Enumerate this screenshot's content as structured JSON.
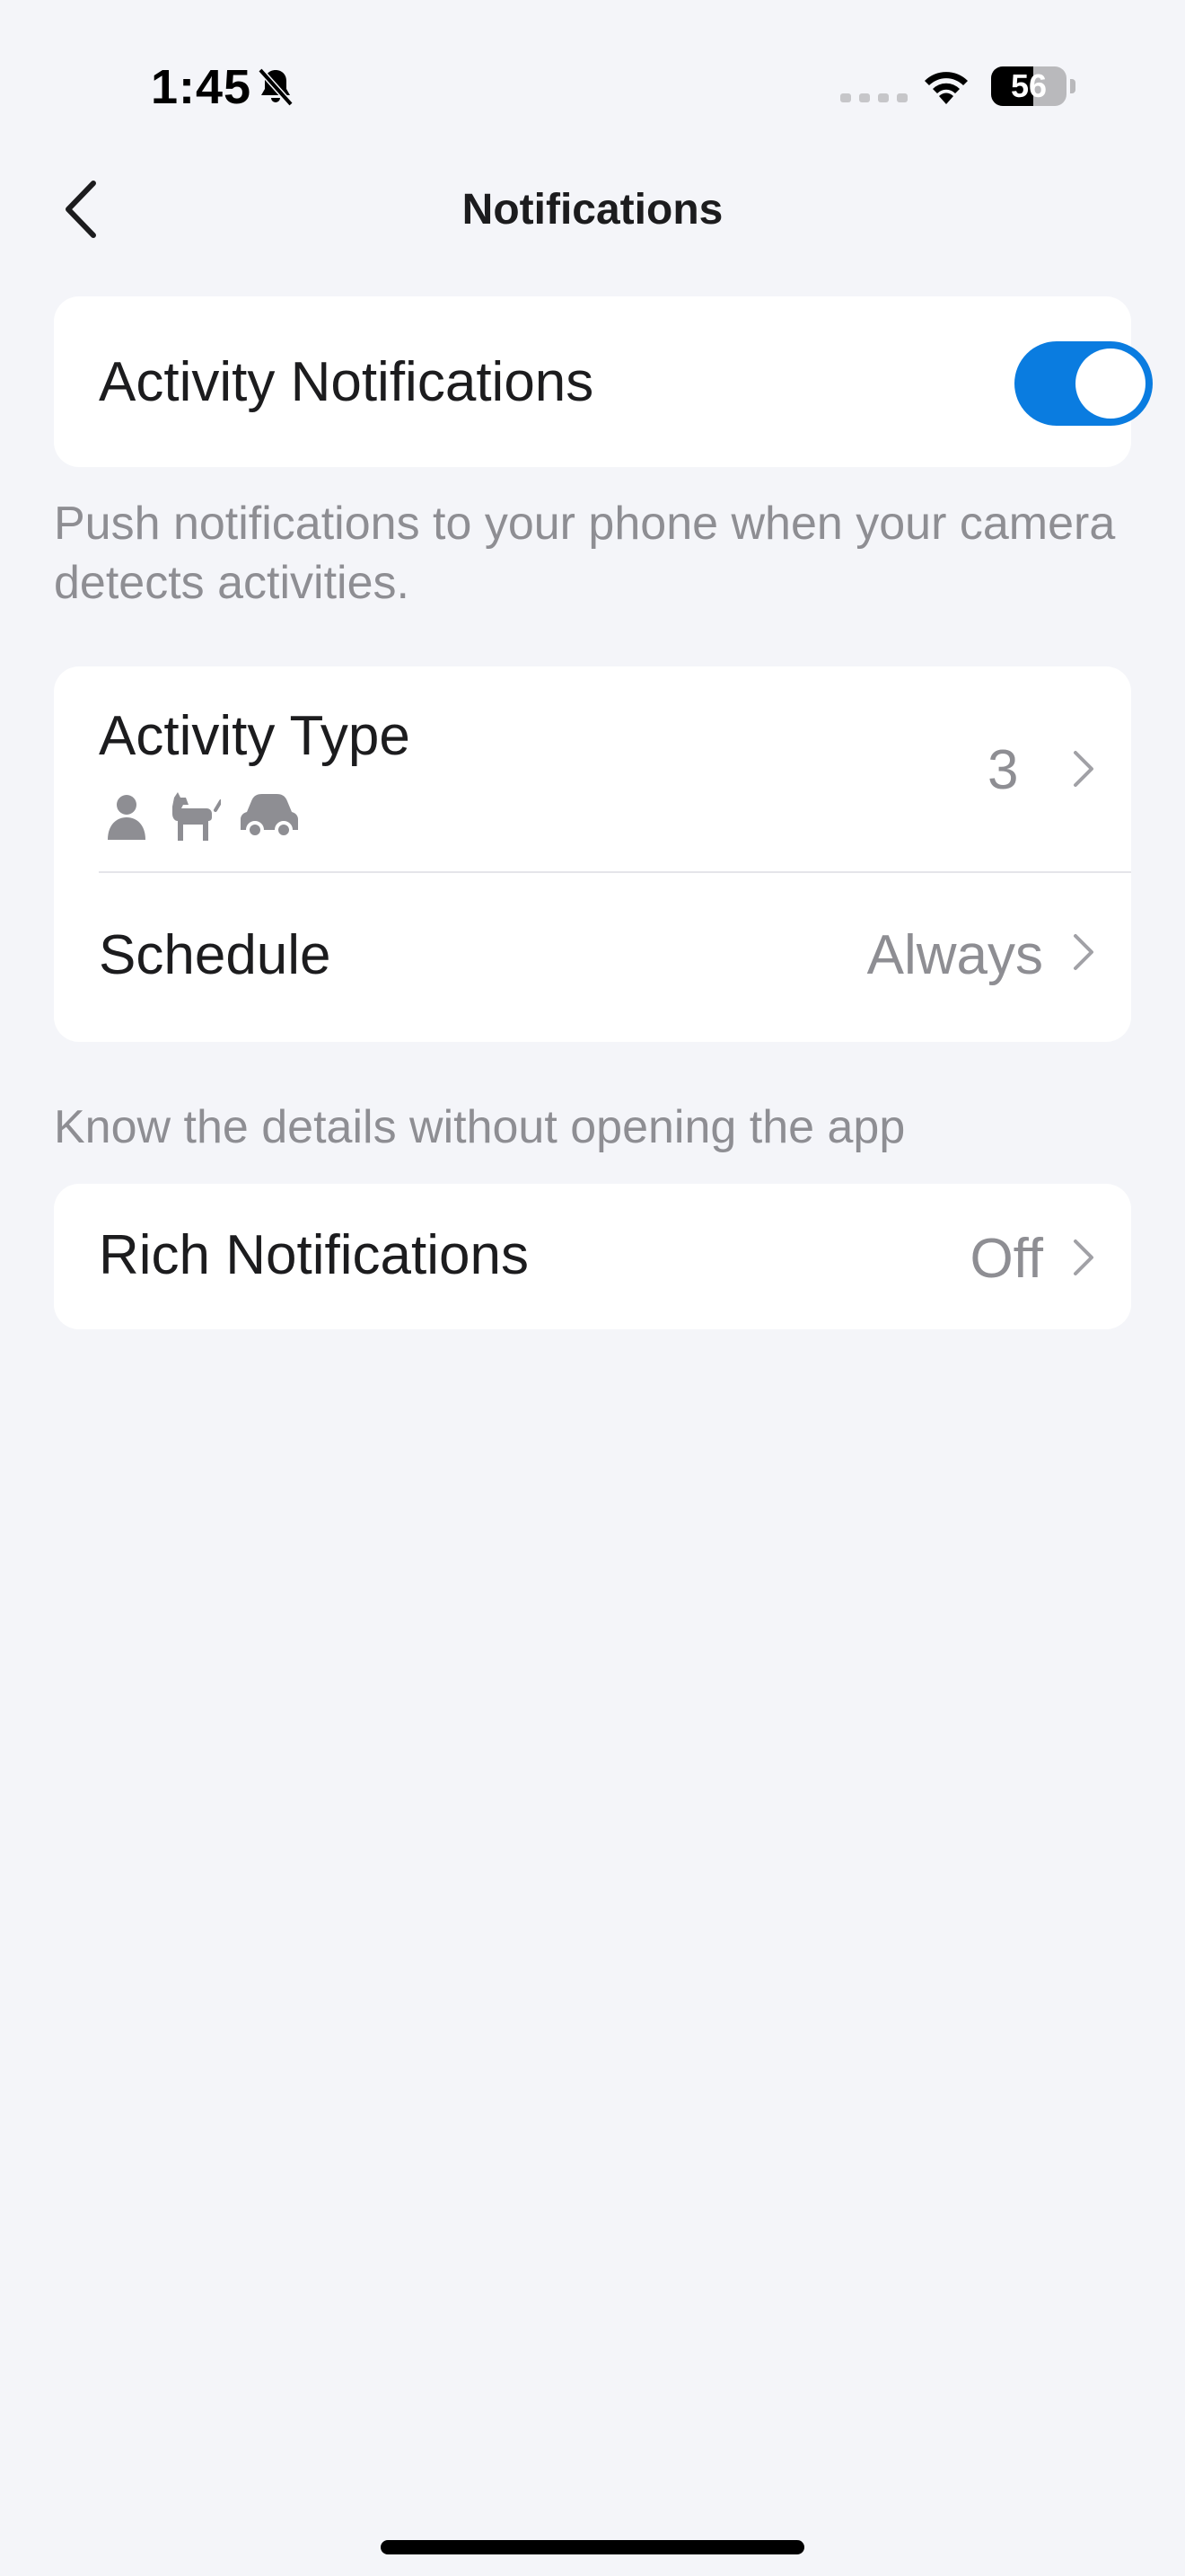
{
  "status_bar": {
    "time": "1:45",
    "battery_level": "56",
    "icons": [
      "bell-slash-icon",
      "cellular-signal-icon",
      "wifi-icon",
      "battery-icon"
    ]
  },
  "nav": {
    "title": "Notifications",
    "back_icon": "chevron-left-icon"
  },
  "activity_notifications": {
    "label": "Activity Notifications",
    "enabled": true,
    "toggle_color": "#0a7ce0",
    "description": "Push notifications to your phone when your camera detects activities."
  },
  "settings": {
    "activity_type": {
      "label": "Activity Type",
      "value": "3",
      "icons": [
        "person-icon",
        "pet-icon",
        "vehicle-icon"
      ]
    },
    "schedule": {
      "label": "Schedule",
      "value": "Always"
    }
  },
  "rich": {
    "caption": "Know the details without opening the app",
    "label": "Rich Notifications",
    "value": "Off"
  }
}
